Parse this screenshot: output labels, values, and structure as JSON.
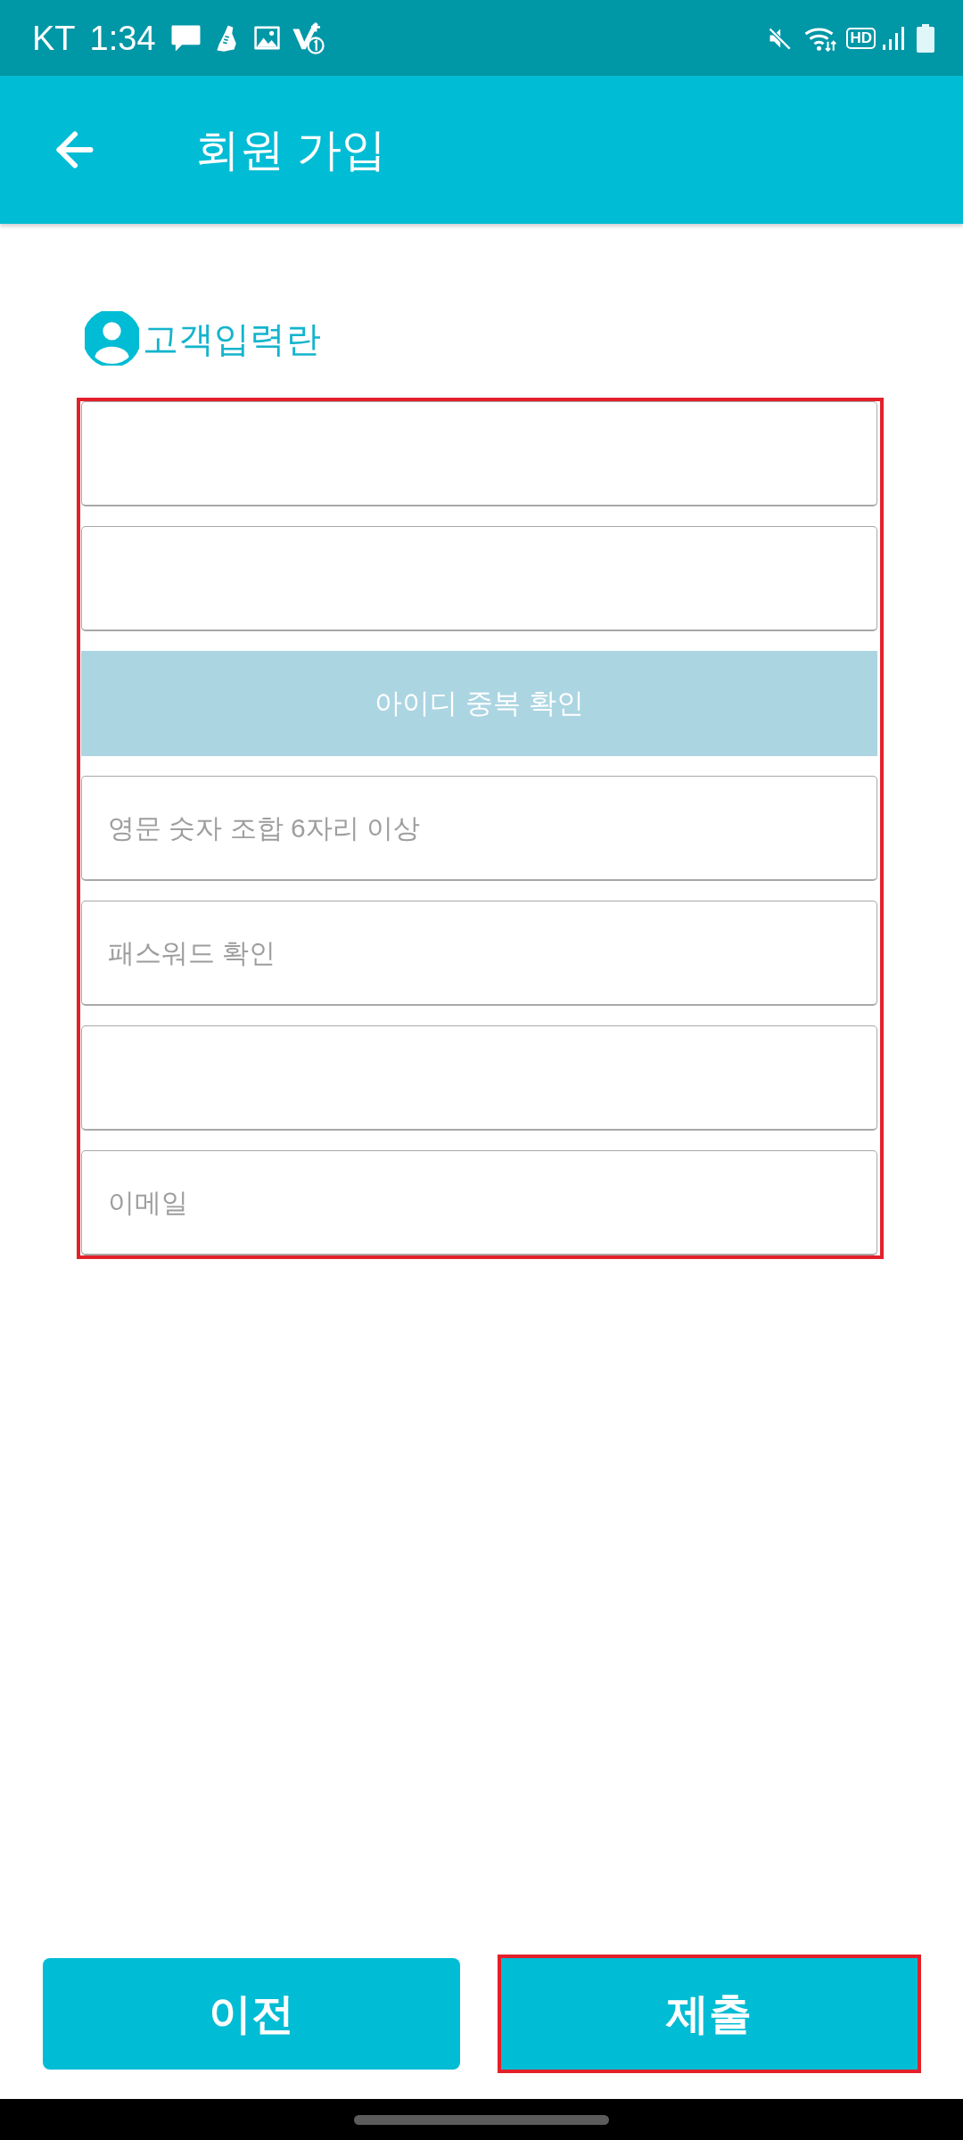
{
  "status_bar": {
    "carrier": "KT",
    "time": "1:34",
    "hd_label": "HD"
  },
  "app_bar": {
    "title": "회원 가입"
  },
  "section": {
    "title": "고객입력란"
  },
  "form": {
    "highlighted": true,
    "items": [
      {
        "kind": "input"
      },
      {
        "kind": "input"
      },
      {
        "kind": "button",
        "label": "아이디 중복 확인"
      },
      {
        "kind": "input",
        "placeholder": "영문 숫자 조합 6자리 이상"
      },
      {
        "kind": "input",
        "placeholder": "패스워드 확인"
      },
      {
        "kind": "input"
      },
      {
        "kind": "input",
        "placeholder": "이메일"
      }
    ]
  },
  "buttons": [
    {
      "label": "이전",
      "highlighted": false
    },
    {
      "label": "제출",
      "highlighted": true
    }
  ]
}
